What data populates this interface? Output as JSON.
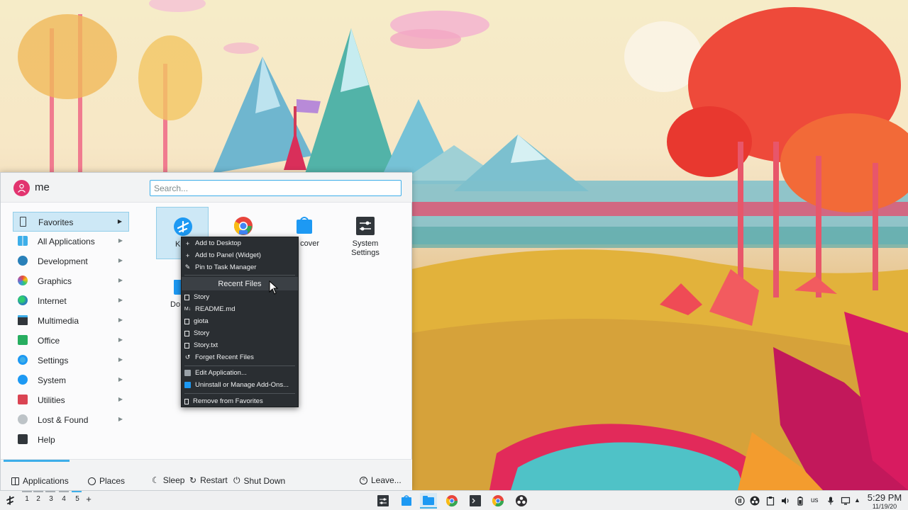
{
  "launcher": {
    "user_name": "me",
    "search_placeholder": "Search...",
    "categories": [
      {
        "label": "Favorites",
        "icon": "bookmark-icon"
      },
      {
        "label": "All Applications",
        "icon": "grid-icon"
      },
      {
        "label": "Development",
        "icon": "code-icon"
      },
      {
        "label": "Graphics",
        "icon": "graphics-icon"
      },
      {
        "label": "Internet",
        "icon": "globe-icon"
      },
      {
        "label": "Multimedia",
        "icon": "monitor-icon"
      },
      {
        "label": "Office",
        "icon": "document-icon"
      },
      {
        "label": "Settings",
        "icon": "settings-icon"
      },
      {
        "label": "System",
        "icon": "system-icon"
      },
      {
        "label": "Utilities",
        "icon": "toolbox-icon"
      },
      {
        "label": "Lost & Found",
        "icon": "dots-icon"
      },
      {
        "label": "Help",
        "icon": "help-icon"
      }
    ],
    "favorites": [
      {
        "label": "K",
        "icon": "kde-app-icon"
      },
      {
        "label": "",
        "icon": "chrome-dev-icon"
      },
      {
        "label": "cover",
        "icon": "discover-icon"
      },
      {
        "label": "System Settings",
        "icon": "system-settings-icon"
      },
      {
        "label": "Do",
        "icon": "dolphin-icon"
      }
    ],
    "footer": {
      "applications": "Applications",
      "places": "Places",
      "sleep": "Sleep",
      "restart": "Restart",
      "shutdown": "Shut Down",
      "leave": "Leave..."
    }
  },
  "context_menu": {
    "actions": [
      "Add to Desktop",
      "Add to Panel (Widget)",
      "Pin to Task Manager"
    ],
    "recent_header": "Recent Files",
    "recent_files": [
      "Story",
      "README.md",
      "giota",
      "Story",
      "Story.txt"
    ],
    "forget": "Forget Recent Files",
    "edit_app": "Edit Application...",
    "uninstall": "Uninstall or Manage Add-Ons...",
    "remove": "Remove from Favorites"
  },
  "taskbar": {
    "pager": [
      "1",
      "2",
      "3",
      "4",
      "5",
      "+"
    ],
    "keyboard_layout": "us",
    "time": "5:29 PM",
    "date": "11/19/20"
  },
  "colors": {
    "accent": "#3daee9",
    "menu_bg": "#2a2e32",
    "avatar": "#e2346f"
  }
}
